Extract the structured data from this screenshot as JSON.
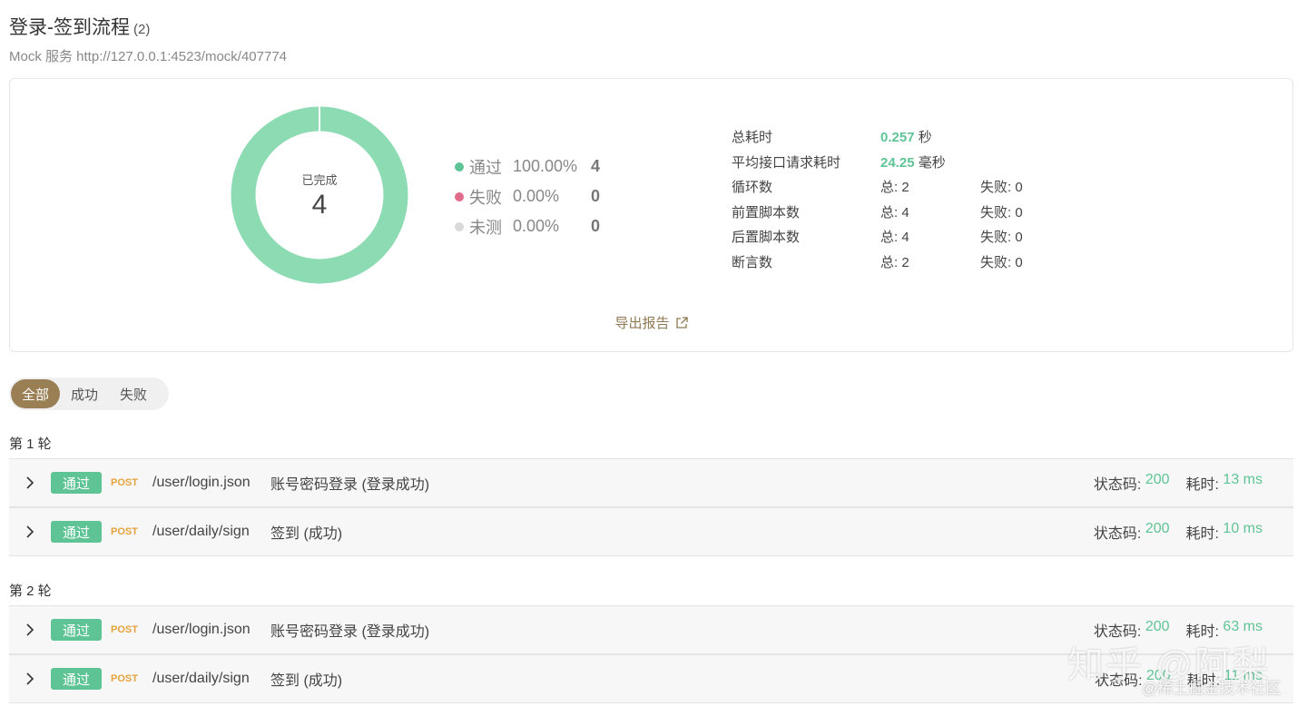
{
  "header": {
    "title": "登录-签到流程",
    "count": "(2)",
    "subtitle": "Mock 服务 http://127.0.0.1:4523/mock/407774"
  },
  "summary": {
    "donut": {
      "label": "已完成",
      "value": "4",
      "pass_fraction": 1.0,
      "color": "#8cdbb3"
    },
    "legend": [
      {
        "name": "通过",
        "pct": "100.00%",
        "count": "4",
        "color": "#5fc495"
      },
      {
        "name": "失败",
        "pct": "0.00%",
        "count": "0",
        "color": "#e06c8a"
      },
      {
        "name": "未测",
        "pct": "0.00%",
        "count": "0",
        "color": "#d9d9d9"
      }
    ],
    "stats": {
      "total_time": {
        "label": "总耗时",
        "value": "0.257",
        "unit": "秒"
      },
      "avg_time": {
        "label": "平均接口请求耗时",
        "value": "24.25",
        "unit": "毫秒"
      },
      "loops": {
        "label": "循环数",
        "total": "总: 2",
        "fail": "失败: 0"
      },
      "pre_scripts": {
        "label": "前置脚本数",
        "total": "总: 4",
        "fail": "失败: 0"
      },
      "post_scripts": {
        "label": "后置脚本数",
        "total": "总: 4",
        "fail": "失败: 0"
      },
      "assertions": {
        "label": "断言数",
        "total": "总: 2",
        "fail": "失败: 0"
      }
    },
    "export_label": "导出报告"
  },
  "filters": [
    {
      "label": "全部",
      "active": true
    },
    {
      "label": "成功",
      "active": false
    },
    {
      "label": "失败",
      "active": false
    }
  ],
  "rounds": [
    {
      "title": "第 1 轮",
      "requests": [
        {
          "status": "通过",
          "method": "POST",
          "path": "/user/login.json",
          "desc": "账号密码登录 (登录成功)",
          "code_label": "状态码:",
          "code": "200",
          "time_label": "耗时:",
          "time": "13 ms"
        },
        {
          "status": "通过",
          "method": "POST",
          "path": "/user/daily/sign",
          "desc": "签到 (成功)",
          "code_label": "状态码:",
          "code": "200",
          "time_label": "耗时:",
          "time": "10 ms"
        }
      ]
    },
    {
      "title": "第 2 轮",
      "requests": [
        {
          "status": "通过",
          "method": "POST",
          "path": "/user/login.json",
          "desc": "账号密码登录 (登录成功)",
          "code_label": "状态码:",
          "code": "200",
          "time_label": "耗时:",
          "time": "63 ms"
        },
        {
          "status": "通过",
          "method": "POST",
          "path": "/user/daily/sign",
          "desc": "签到 (成功)",
          "code_label": "状态码:",
          "code": "200",
          "time_label": "耗时:",
          "time": "11 ms"
        }
      ]
    }
  ],
  "watermark": {
    "line1": "知乎 @阿梨",
    "line2": "@稀土掘金技术社区"
  }
}
